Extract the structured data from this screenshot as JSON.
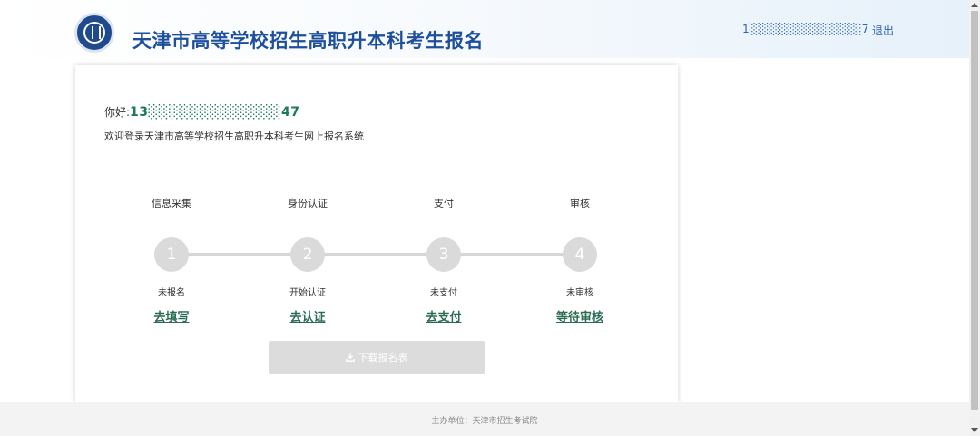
{
  "header": {
    "title": "天津市高等学校招生高职升本科考生报名",
    "account": "1░░░░░░░░░░░░░7",
    "logout_label": "退出"
  },
  "card": {
    "greeting_prefix": "你好:",
    "greeting_id": "13░░░░░░░░░░░░░47",
    "welcome": "欢迎登录天津市高等学校招生高职升本科考生网上报名系统"
  },
  "steps": [
    {
      "title": "信息采集",
      "number": "1",
      "status": "未报名",
      "action": "去填写"
    },
    {
      "title": "身份认证",
      "number": "2",
      "status": "开始认证",
      "action": "去认证"
    },
    {
      "title": "支付",
      "number": "3",
      "status": "未支付",
      "action": "去支付"
    },
    {
      "title": "审核",
      "number": "4",
      "status": "未审核",
      "action": "等待审核"
    }
  ],
  "download": {
    "label": "下载报名表",
    "icon": "download-icon"
  },
  "footer": {
    "text": "主办单位：天津市招生考试院"
  },
  "colors": {
    "brand": "#1e4f9c",
    "link": "#2a6b52",
    "step_circle": "#dadada"
  }
}
